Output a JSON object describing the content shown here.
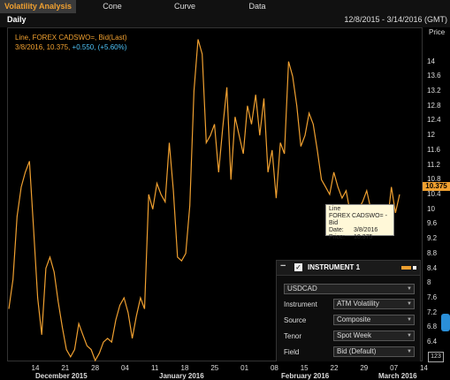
{
  "tabs": [
    {
      "label": "Volatility Analysis",
      "active": true
    },
    {
      "label": "Cone"
    },
    {
      "label": "Curve"
    },
    {
      "label": "Data"
    }
  ],
  "subheader": {
    "frequency": "Daily",
    "range": "12/8/2015 - 3/14/2016 (GMT)"
  },
  "legend": {
    "line1": "Line, FOREX CADSWO=, Bid(Last)",
    "date": "3/8/2016,",
    "value": "10.375,",
    "change": "+0.550, (+5.60%)"
  },
  "tooltip": {
    "title": "Line",
    "series": "FOREX CADSWO= - Bid",
    "date_label": "Date:",
    "date_value": "3/8/2016",
    "price_label": "Price:",
    "price_value": "10.375"
  },
  "axis": {
    "y_title": "Price",
    "last_value": "10.375",
    "bottom_right_value": "123"
  },
  "panel": {
    "title": "INSTRUMENT 1",
    "symbol": "USDCAD",
    "fields": [
      {
        "label": "Instrument",
        "value": "ATM Volatility"
      },
      {
        "label": "Source",
        "value": "Composite"
      },
      {
        "label": "Tenor",
        "value": "Spot Week"
      },
      {
        "label": "Field",
        "value": "Bid (Default)"
      }
    ]
  },
  "colors": {
    "line": "#f0a030",
    "change": "#4fc3f7",
    "background": "#000000"
  },
  "chart_data": {
    "type": "line",
    "title": "",
    "series": [
      {
        "name": "Line, FOREX CADSWO=, Bid(Last)",
        "values": [
          7.3,
          8.1,
          9.8,
          10.6,
          11.0,
          11.3,
          9.5,
          7.6,
          6.6,
          8.4,
          8.7,
          8.3,
          7.5,
          6.8,
          6.2,
          6.0,
          6.2,
          6.9,
          6.6,
          6.3,
          6.2,
          5.9,
          6.1,
          6.4,
          6.5,
          6.4,
          7.0,
          7.4,
          7.6,
          7.2,
          6.5,
          7.1,
          7.6,
          7.3,
          10.4,
          10.0,
          10.7,
          10.4,
          10.2,
          11.8,
          10.5,
          8.7,
          8.6,
          8.8,
          10.1,
          13.2,
          14.6,
          14.2,
          11.8,
          12.0,
          12.3,
          11.0,
          12.2,
          13.3,
          10.8,
          12.5,
          12.0,
          11.5,
          12.8,
          12.3,
          13.1,
          12.0,
          13.0,
          11.0,
          11.6,
          10.3,
          11.8,
          11.5,
          14.0,
          13.6,
          12.8,
          11.7,
          12.0,
          12.6,
          12.3,
          11.6,
          10.8,
          10.6,
          10.4,
          11.0,
          10.6,
          10.3,
          10.5,
          9.9,
          9.9,
          10.0,
          10.2,
          10.5,
          10.0,
          9.9,
          10.1,
          9.8,
          9.6,
          10.6,
          9.9,
          10.4
        ]
      }
    ],
    "x_tick_labels": [
      "14",
      "21",
      "28",
      "04",
      "11",
      "18",
      "25",
      "01",
      "08",
      "15",
      "22",
      "29",
      "07",
      "14"
    ],
    "month_labels": [
      "December 2015",
      "January 2016",
      "February 2016",
      "March 2016"
    ],
    "y_tick_labels": [
      "6.4",
      "6.8",
      "7.2",
      "7.6",
      "8",
      "8.4",
      "8.8",
      "9.2",
      "9.6",
      "10",
      "10.4",
      "10.8",
      "11.2",
      "11.6",
      "12",
      "12.4",
      "12.8",
      "13.2",
      "13.6",
      "14"
    ],
    "ylim": [
      5.9,
      14.9
    ],
    "grid": false,
    "legend": "top-left"
  }
}
